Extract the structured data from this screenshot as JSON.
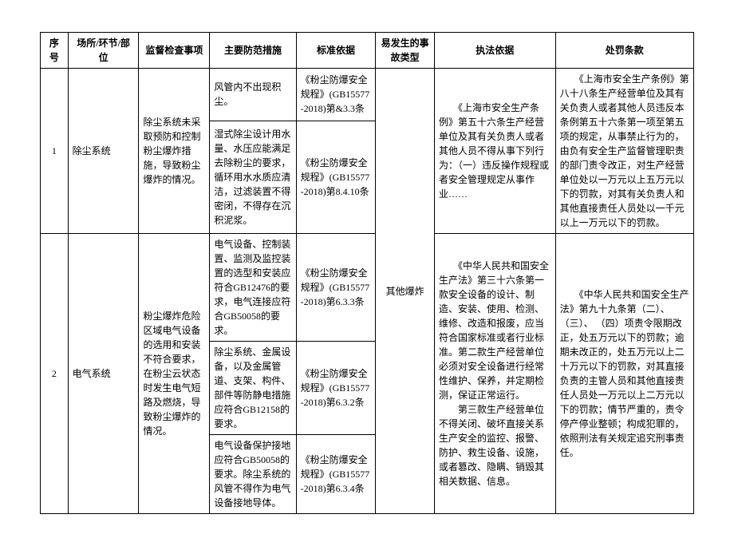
{
  "headers": {
    "seq": "序号",
    "place": "场所/环节/部位",
    "inspection": "监督检查事项",
    "measure": "主要防范措施",
    "standard": "标准依据",
    "accident_type": "易发生的事故类型",
    "law_basis": "执法依据",
    "penalty": "处罚条款"
  },
  "shared": {
    "accident_type": "其他爆炸"
  },
  "rows": [
    {
      "seq": "1",
      "place": "除尘系统",
      "inspection": "除尘系统未采取预防和控制粉尘爆炸措施，导致粉尘爆炸的情况。",
      "items": [
        {
          "measure": "风管内不出现积尘。",
          "standard": "《粉尘防爆安全规程》(GB15577-2018)第&3.3条"
        },
        {
          "measure": "湿式除尘设计用水量、水压应能满足去除粉尘的要求，循环用水水质应清洁，过滤装置不得密闭，不得存在沉积泥浆。",
          "standard": "《粉尘防爆安全规程》(GB15577-2018)第8.4.10条"
        }
      ],
      "law_basis": "　　《上海市安全生产条例》第五十六条生产经营单位及其有关负责人或者其他人员不得从事下列行为：（一）违反操作规程或者安全管理规定从事作业……",
      "penalty": "　　《上海市安全生产条例》第八十八条生产经营单位及其有关负责人或者其他人员违反本条例第五十六条第一项至第五项的规定，从事禁止行为的，由负有安全生产监督管理职责的部门责令改正，对生产经营单位处以一万元以上五万元以下的罚款，对其有关负责人和其他直接责任人员处以一千元以上一万元以下的罚款。"
    },
    {
      "seq": "2",
      "place": "电气系统",
      "inspection": "粉尘爆炸危险区域电气设备的选用和安装不符合要求，在粉尘云状态时发生电气短路及燃烧，导致粉尘爆炸的情况。",
      "items": [
        {
          "measure": "电气设备、控制装置、监测及监控装置的选型和安装应符合GB12476的要求，电气连接应符合GB50058的要求。",
          "standard": "《粉尘防爆安全规程》(GB15577-2018)第6.3.3条"
        },
        {
          "measure": "除尘系统、金属设备，以及金属管道、支架、构件、部件等防静电措施应符合GB12158的要求。",
          "standard": "《粉尘防爆安全规程》(GB15577-2018)第6.3.2条"
        },
        {
          "measure": "电气设备保护接地应符合GB50058的要求。除尘系统的风管不得作为电气设备接地导体。",
          "standard": "《粉尘防爆安全规程》(GB15577-2018)第6.3.4条"
        }
      ],
      "law_basis": "　　《中华人民共和国安全生产法》第三十六条第一款安全设备的设计、制造、安装、使用、检测、维修、改造和报废，应当符合国家标准或者行业标准。第二款生产经营单位必须对安全设备进行经常性维护、保养，并定期检测，保证正常运行。\n　　第三款生产经营单位不得关闭、破坏直接关系生产安全的监控、报警、防护、救生设备、设施，或者篡改、隐瞒、销毁其相关数据、信息。",
      "penalty": "　　《中华人民共和国安全生产法》第九十九条第（二）、（三）、\n（四）项责令限期改正，处五万元以下的罚款；逾期未改正的，处五万元以上二十万元以下的罚款，对其直接负责的主管人员和其他直接责任人员处一万元以上二万元以下的罚款；情节严重的，责令停产停业整顿；构成犯罪的，依照刑法有关规定追究刑事责任。"
    }
  ]
}
